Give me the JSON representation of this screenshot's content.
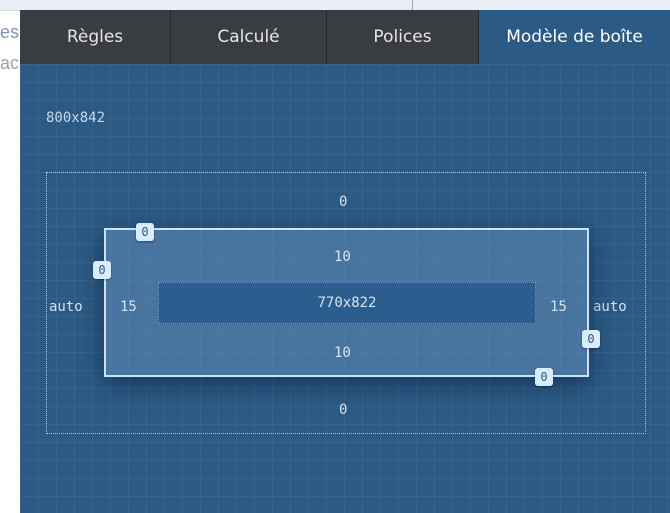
{
  "background": {
    "word1": "es",
    "word2": "ac"
  },
  "tabs": [
    {
      "label": "Règles",
      "active": false
    },
    {
      "label": "Calculé",
      "active": false
    },
    {
      "label": "Polices",
      "active": false
    },
    {
      "label": "Modèle de boîte",
      "active": true
    }
  ],
  "box_model": {
    "element_size": "800x842",
    "margin": {
      "top": "0",
      "right": "auto",
      "bottom": "0",
      "left": "auto"
    },
    "border": {
      "top": "0",
      "right": "0",
      "bottom": "0",
      "left": "0"
    },
    "padding": {
      "top": "10",
      "right": "15",
      "bottom": "10",
      "left": "15"
    },
    "content_size": "770x822"
  },
  "colors": {
    "panel_background": "#2b5a85",
    "tabbar_background": "#393c40",
    "badge_background": "#d9ecfb"
  }
}
